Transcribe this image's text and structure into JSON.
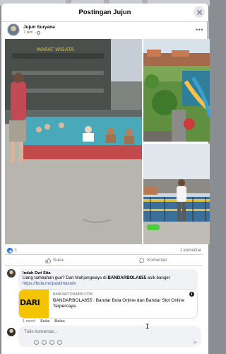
{
  "modal": {
    "title": "Postingan Jujun"
  },
  "post": {
    "author": "Jujun Suryana",
    "time": "7 jam",
    "photo_sign": "MARAT WISATA"
  },
  "stats": {
    "likes": "1",
    "comments": "1 komentar"
  },
  "actions": {
    "like": "Suka",
    "comment": "Komentar"
  },
  "comment": {
    "author": "Indah Dwi Sita",
    "text_before": "Uang tambahan gue? Dari Mahjongways di ",
    "brand": "BANDARBOLA855",
    "text_after": " asik banget",
    "link": "https://bola.mx/pastimaxwin",
    "preview": {
      "domain": "BANDARTORA855.COM",
      "title": "BANDARBOLA855 : Bandar Bola Online dan Bandar Slot Online Terpercaya",
      "thumb_text": "DARI"
    },
    "time": "1 menit",
    "like_label": "Suka",
    "reply_label": "Balas"
  },
  "composer": {
    "placeholder": "Tulis komentar..."
  },
  "colors": {
    "accent": "#1877f2",
    "link": "#385898",
    "bubble": "#f0f2f5"
  },
  "icons": [
    "close-icon",
    "globe-icon",
    "more-icon",
    "like-icon",
    "comment-icon",
    "info-icon",
    "emoji-icon",
    "camera-icon",
    "gif-icon",
    "sticker-icon",
    "send-icon"
  ]
}
